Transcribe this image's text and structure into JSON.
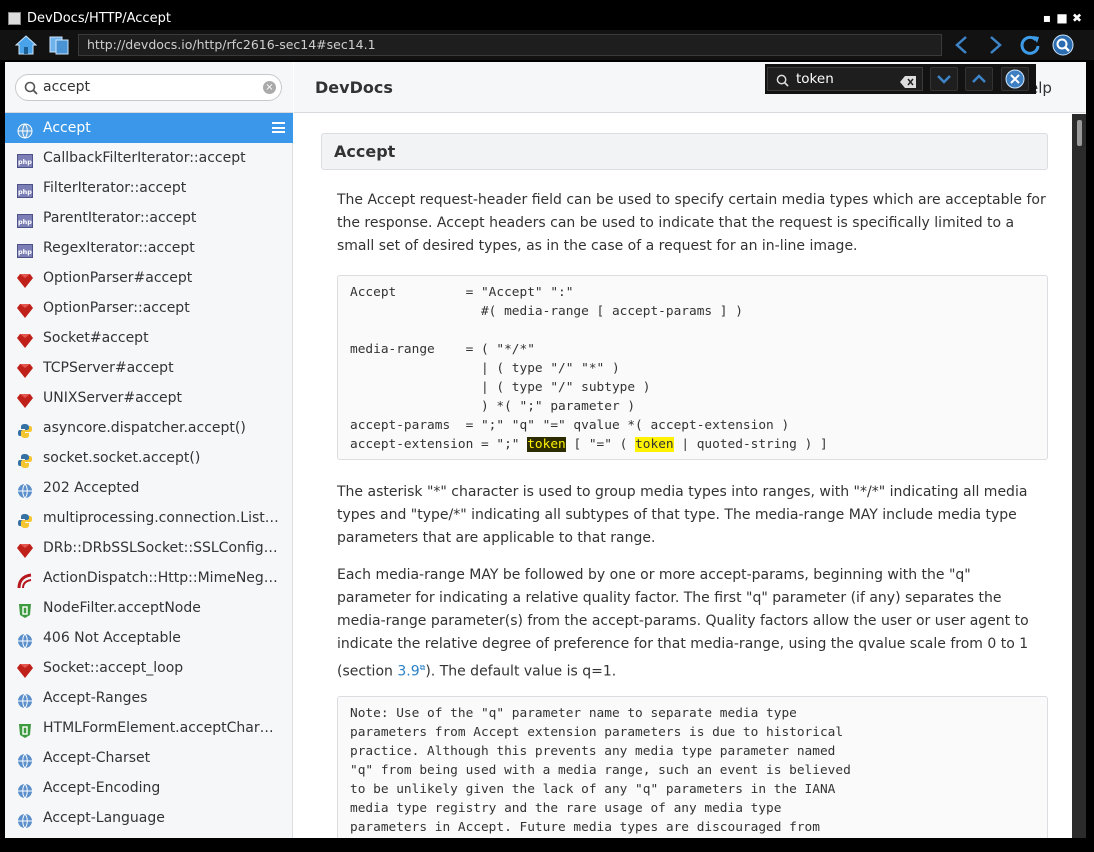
{
  "window": {
    "title": "DevDocs/HTTP/Accept",
    "minimize_glyph": "▪",
    "maximize_glyph": "■",
    "close_glyph": "✖"
  },
  "toolbar": {
    "url": "http://devdocs.io/http/rfc2616-sec14#sec14.1"
  },
  "sidebar": {
    "search_value": "accept",
    "items": [
      {
        "label": "Accept",
        "icon": "http-globe-icon",
        "active": true
      },
      {
        "label": "CallbackFilterIterator::accept",
        "icon": "php-icon"
      },
      {
        "label": "FilterIterator::accept",
        "icon": "php-icon"
      },
      {
        "label": "ParentIterator::accept",
        "icon": "php-icon"
      },
      {
        "label": "RegexIterator::accept",
        "icon": "php-icon"
      },
      {
        "label": "OptionParser#accept",
        "icon": "ruby-icon"
      },
      {
        "label": "OptionParser::accept",
        "icon": "ruby-icon"
      },
      {
        "label": "Socket#accept",
        "icon": "ruby-icon"
      },
      {
        "label": "TCPServer#accept",
        "icon": "ruby-icon"
      },
      {
        "label": "UNIXServer#accept",
        "icon": "ruby-icon"
      },
      {
        "label": "asyncore.dispatcher.accept()",
        "icon": "python-icon"
      },
      {
        "label": "socket.socket.accept()",
        "icon": "python-icon"
      },
      {
        "label": "202 Accepted",
        "icon": "http-globe-icon"
      },
      {
        "label": "multiprocessing.connection.Liste…",
        "icon": "python-icon"
      },
      {
        "label": "DRb::DRbSSLSocket::SSLConfig#a…",
        "icon": "ruby-icon"
      },
      {
        "label": "ActionDispatch::Http::MimeNego…",
        "icon": "rails-icon"
      },
      {
        "label": "NodeFilter.acceptNode",
        "icon": "dom-shield-icon"
      },
      {
        "label": "406 Not Acceptable",
        "icon": "http-globe-icon"
      },
      {
        "label": "Socket::accept_loop",
        "icon": "ruby-icon"
      },
      {
        "label": "Accept-Ranges",
        "icon": "http-globe-icon"
      },
      {
        "label": "HTMLFormElement.acceptCharset",
        "icon": "dom-shield-icon"
      },
      {
        "label": "Accept-Charset",
        "icon": "http-globe-icon"
      },
      {
        "label": "Accept-Encoding",
        "icon": "http-globe-icon"
      },
      {
        "label": "Accept-Language",
        "icon": "http-globe-icon"
      }
    ]
  },
  "main": {
    "brand": "DevDocs",
    "help": "elp",
    "doc_title": "Accept",
    "intro": "The Accept request-header field can be used to specify certain media types which are acceptable for the response. Accept headers can be used to indicate that the request is specifically limited to a small set of desired types, as in the case of a request for an in-line image.",
    "code1": {
      "l1": "Accept         = \"Accept\" \":\"",
      "l2": "                 #( media-range [ accept-params ] )",
      "l3": "",
      "l4": "media-range    = ( \"*/*\"",
      "l5": "                 | ( type \"/\" \"*\" )",
      "l6": "                 | ( type \"/\" subtype )",
      "l7": "                 ) *( \";\" parameter )",
      "l8": "accept-params  = \";\" \"q\" \"=\" qvalue *( accept-extension )",
      "l9_a": "accept-extension = \";\" ",
      "l9_hl1": "token",
      "l9_b": " [ \"=\" ( ",
      "l9_hl2": "token",
      "l9_c": " | quoted-string ) ]"
    },
    "para2": "The asterisk \"*\" character is used to group media types into ranges, with \"*/*\" indicating all media types and \"type/*\" indicating all subtypes of that type. The media-range MAY include media type parameters that are applicable to that range.",
    "para3_a": "Each media-range MAY be followed by one or more accept-params, beginning with the \"q\" parameter for indicating a relative quality factor. The first \"q\" parameter (if any) separates the media-range parameter(s) from the accept-params. Quality factors allow the user or user agent to indicate the relative degree of preference for that media-range, using the qvalue scale from 0 to 1 (section ",
    "para3_link": "3.9",
    "para3_b": "). The default value is q=1.",
    "note": "Note: Use of the \"q\" parameter name to separate media type\nparameters from Accept extension parameters is due to historical\npractice. Although this prevents any media type parameter named\n\"q\" from being used with a media range, such an event is believed\nto be unlikely given the lack of any \"q\" parameters in the IANA\nmedia type registry and the rare usage of any media type\nparameters in Accept. Future media types are discouraged from"
  },
  "findbar": {
    "query": "token"
  },
  "colors": {
    "accent": "#3a97e9",
    "highlight": "#fff200",
    "link": "#2a80c6"
  }
}
